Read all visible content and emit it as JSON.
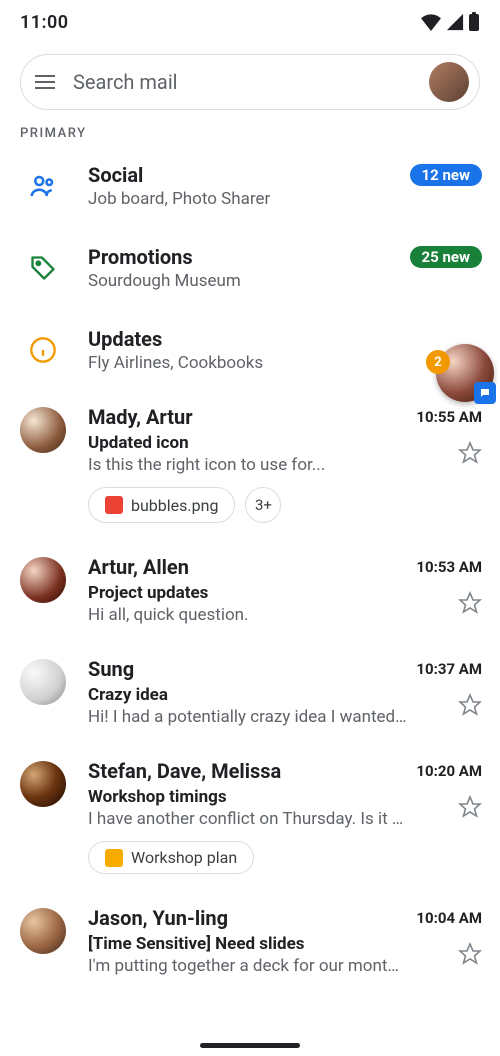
{
  "status": {
    "time": "11:00"
  },
  "search": {
    "placeholder": "Search mail"
  },
  "section_label": "PRIMARY",
  "categories": [
    {
      "name": "Social",
      "subtitle": "Job board, Photo Sharer",
      "badge": "12 new",
      "badge_color": "blue",
      "icon": "people"
    },
    {
      "name": "Promotions",
      "subtitle": "Sourdough Museum",
      "badge": "25 new",
      "badge_color": "green",
      "icon": "tag"
    },
    {
      "name": "Updates",
      "subtitle": "Fly Airlines, Cookbooks",
      "badge": "",
      "badge_color": "",
      "icon": "info"
    }
  ],
  "emails": [
    {
      "sender": "Mady, Artur",
      "time": "10:55 AM",
      "subject": "Updated icon",
      "snippet": "Is this the right icon to use for...",
      "avatar": "av-mady",
      "chips": [
        {
          "type": "img",
          "label": "bubbles.png"
        }
      ],
      "extra_chip": "3+"
    },
    {
      "sender": "Artur, Allen",
      "time": "10:53 AM",
      "subject": "Project updates",
      "snippet": "Hi all, quick question.",
      "avatar": "av-artur"
    },
    {
      "sender": "Sung",
      "time": "10:37 AM",
      "subject": "Crazy idea",
      "snippet": "Hi! I had a potentially crazy idea I wanted to...",
      "avatar": "av-sung"
    },
    {
      "sender": "Stefan, Dave, Melissa",
      "time": "10:20 AM",
      "subject": "Workshop timings",
      "snippet": "I have another conflict on Thursday. Is it po...",
      "avatar": "av-stefan",
      "chips": [
        {
          "type": "slides",
          "label": "Workshop plan"
        }
      ]
    },
    {
      "sender": "Jason, Yun-ling",
      "time": "10:04 AM",
      "subject": "[Time Sensitive] Need slides",
      "snippet": "I'm putting together a deck for our monthly...",
      "avatar": "av-jason"
    }
  ],
  "floating": {
    "badge": "2"
  }
}
